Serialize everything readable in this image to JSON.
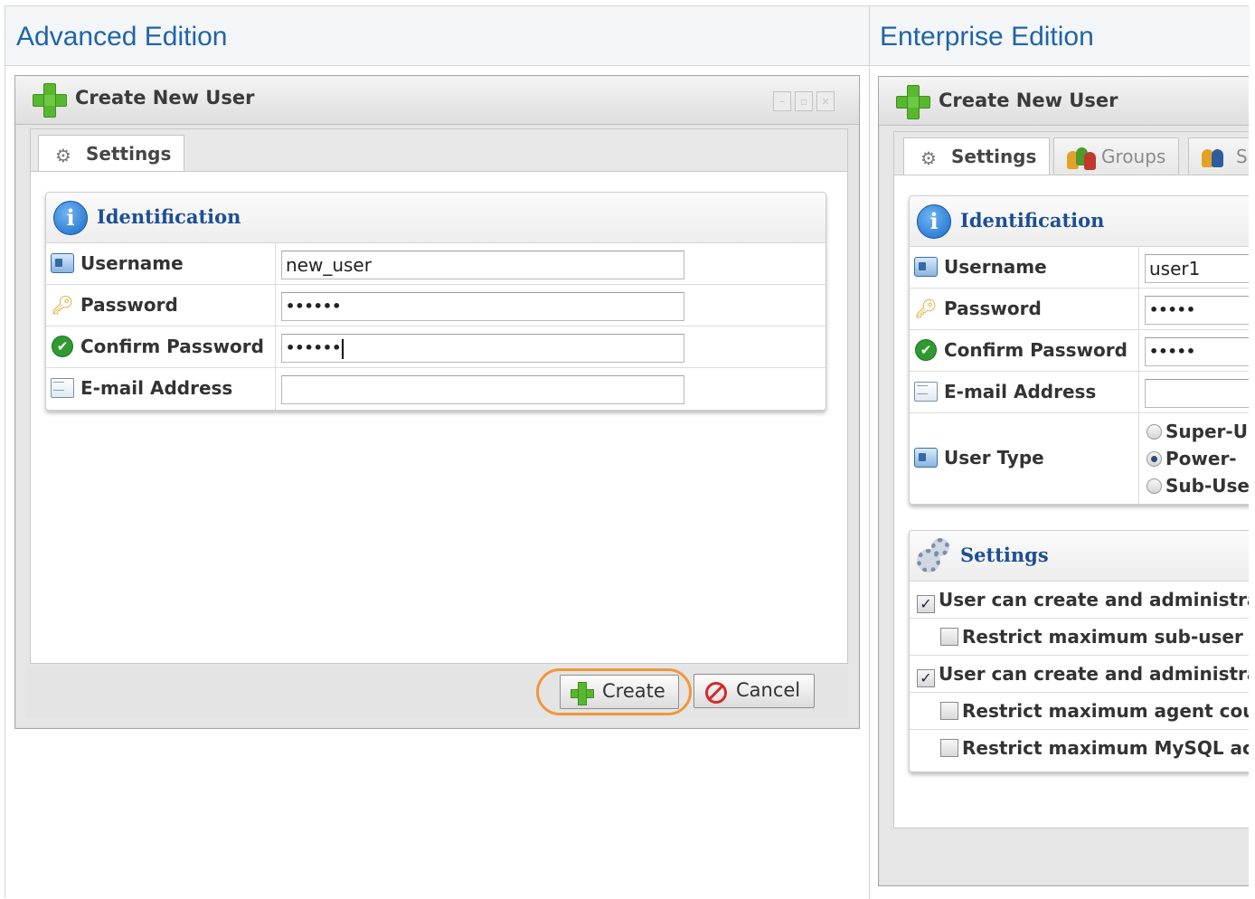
{
  "headers": {
    "left": "Advanced Edition",
    "right": "Enterprise Edition"
  },
  "window_title": "Create New User",
  "window_controls": [
    "–",
    "▫",
    "×"
  ],
  "tabs_left": [
    {
      "label": "Settings",
      "icon": "gears-icon"
    }
  ],
  "tabs_right": [
    {
      "label": "Settings",
      "icon": "gears-icon"
    },
    {
      "label": "Groups",
      "icon": "groups-icon"
    },
    {
      "label": "S",
      "icon": "users-icon"
    }
  ],
  "identification_title": "Identification",
  "fields": {
    "username_label": "Username",
    "password_label": "Password",
    "confirm_label": "Confirm Password",
    "email_label": "E-mail Address",
    "user_type_label": "User Type"
  },
  "left_values": {
    "username": "new_user",
    "password": "••••••",
    "confirm": "••••••",
    "email": ""
  },
  "right_values": {
    "username": "user1",
    "password": "•••••",
    "confirm": "•••••",
    "email": ""
  },
  "user_types": [
    {
      "label": "Super-U",
      "selected": false
    },
    {
      "label": "Power-",
      "selected": true
    },
    {
      "label": "Sub-Use",
      "selected": false
    }
  ],
  "settings_title": "Settings",
  "settings_options": [
    {
      "label": "User can create and administra",
      "checked": true,
      "indent": false
    },
    {
      "label": "Restrict maximum sub-user",
      "checked": false,
      "indent": true
    },
    {
      "label": "User can create and administra",
      "checked": true,
      "indent": false
    },
    {
      "label": "Restrict maximum agent cou",
      "checked": false,
      "indent": true
    },
    {
      "label": "Restrict maximum MySQL ac",
      "checked": false,
      "indent": true
    }
  ],
  "buttons": {
    "create": "Create",
    "cancel": "Cancel"
  },
  "colors": {
    "header_text": "#1f65a8",
    "fieldset_title": "#1c4f94",
    "highlight": "#f1973a",
    "plus_green": "#57b82f"
  }
}
